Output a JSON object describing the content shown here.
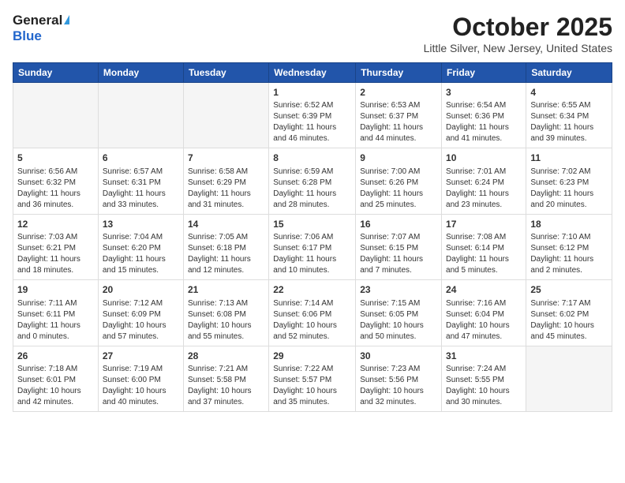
{
  "header": {
    "logo_general": "General",
    "logo_blue": "Blue",
    "month_title": "October 2025",
    "location": "Little Silver, New Jersey, United States"
  },
  "weekdays": [
    "Sunday",
    "Monday",
    "Tuesday",
    "Wednesday",
    "Thursday",
    "Friday",
    "Saturday"
  ],
  "weeks": [
    [
      {
        "day": "",
        "info": ""
      },
      {
        "day": "",
        "info": ""
      },
      {
        "day": "",
        "info": ""
      },
      {
        "day": "1",
        "info": "Sunrise: 6:52 AM\nSunset: 6:39 PM\nDaylight: 11 hours\nand 46 minutes."
      },
      {
        "day": "2",
        "info": "Sunrise: 6:53 AM\nSunset: 6:37 PM\nDaylight: 11 hours\nand 44 minutes."
      },
      {
        "day": "3",
        "info": "Sunrise: 6:54 AM\nSunset: 6:36 PM\nDaylight: 11 hours\nand 41 minutes."
      },
      {
        "day": "4",
        "info": "Sunrise: 6:55 AM\nSunset: 6:34 PM\nDaylight: 11 hours\nand 39 minutes."
      }
    ],
    [
      {
        "day": "5",
        "info": "Sunrise: 6:56 AM\nSunset: 6:32 PM\nDaylight: 11 hours\nand 36 minutes."
      },
      {
        "day": "6",
        "info": "Sunrise: 6:57 AM\nSunset: 6:31 PM\nDaylight: 11 hours\nand 33 minutes."
      },
      {
        "day": "7",
        "info": "Sunrise: 6:58 AM\nSunset: 6:29 PM\nDaylight: 11 hours\nand 31 minutes."
      },
      {
        "day": "8",
        "info": "Sunrise: 6:59 AM\nSunset: 6:28 PM\nDaylight: 11 hours\nand 28 minutes."
      },
      {
        "day": "9",
        "info": "Sunrise: 7:00 AM\nSunset: 6:26 PM\nDaylight: 11 hours\nand 25 minutes."
      },
      {
        "day": "10",
        "info": "Sunrise: 7:01 AM\nSunset: 6:24 PM\nDaylight: 11 hours\nand 23 minutes."
      },
      {
        "day": "11",
        "info": "Sunrise: 7:02 AM\nSunset: 6:23 PM\nDaylight: 11 hours\nand 20 minutes."
      }
    ],
    [
      {
        "day": "12",
        "info": "Sunrise: 7:03 AM\nSunset: 6:21 PM\nDaylight: 11 hours\nand 18 minutes."
      },
      {
        "day": "13",
        "info": "Sunrise: 7:04 AM\nSunset: 6:20 PM\nDaylight: 11 hours\nand 15 minutes."
      },
      {
        "day": "14",
        "info": "Sunrise: 7:05 AM\nSunset: 6:18 PM\nDaylight: 11 hours\nand 12 minutes."
      },
      {
        "day": "15",
        "info": "Sunrise: 7:06 AM\nSunset: 6:17 PM\nDaylight: 11 hours\nand 10 minutes."
      },
      {
        "day": "16",
        "info": "Sunrise: 7:07 AM\nSunset: 6:15 PM\nDaylight: 11 hours\nand 7 minutes."
      },
      {
        "day": "17",
        "info": "Sunrise: 7:08 AM\nSunset: 6:14 PM\nDaylight: 11 hours\nand 5 minutes."
      },
      {
        "day": "18",
        "info": "Sunrise: 7:10 AM\nSunset: 6:12 PM\nDaylight: 11 hours\nand 2 minutes."
      }
    ],
    [
      {
        "day": "19",
        "info": "Sunrise: 7:11 AM\nSunset: 6:11 PM\nDaylight: 11 hours\nand 0 minutes."
      },
      {
        "day": "20",
        "info": "Sunrise: 7:12 AM\nSunset: 6:09 PM\nDaylight: 10 hours\nand 57 minutes."
      },
      {
        "day": "21",
        "info": "Sunrise: 7:13 AM\nSunset: 6:08 PM\nDaylight: 10 hours\nand 55 minutes."
      },
      {
        "day": "22",
        "info": "Sunrise: 7:14 AM\nSunset: 6:06 PM\nDaylight: 10 hours\nand 52 minutes."
      },
      {
        "day": "23",
        "info": "Sunrise: 7:15 AM\nSunset: 6:05 PM\nDaylight: 10 hours\nand 50 minutes."
      },
      {
        "day": "24",
        "info": "Sunrise: 7:16 AM\nSunset: 6:04 PM\nDaylight: 10 hours\nand 47 minutes."
      },
      {
        "day": "25",
        "info": "Sunrise: 7:17 AM\nSunset: 6:02 PM\nDaylight: 10 hours\nand 45 minutes."
      }
    ],
    [
      {
        "day": "26",
        "info": "Sunrise: 7:18 AM\nSunset: 6:01 PM\nDaylight: 10 hours\nand 42 minutes."
      },
      {
        "day": "27",
        "info": "Sunrise: 7:19 AM\nSunset: 6:00 PM\nDaylight: 10 hours\nand 40 minutes."
      },
      {
        "day": "28",
        "info": "Sunrise: 7:21 AM\nSunset: 5:58 PM\nDaylight: 10 hours\nand 37 minutes."
      },
      {
        "day": "29",
        "info": "Sunrise: 7:22 AM\nSunset: 5:57 PM\nDaylight: 10 hours\nand 35 minutes."
      },
      {
        "day": "30",
        "info": "Sunrise: 7:23 AM\nSunset: 5:56 PM\nDaylight: 10 hours\nand 32 minutes."
      },
      {
        "day": "31",
        "info": "Sunrise: 7:24 AM\nSunset: 5:55 PM\nDaylight: 10 hours\nand 30 minutes."
      },
      {
        "day": "",
        "info": ""
      }
    ]
  ]
}
